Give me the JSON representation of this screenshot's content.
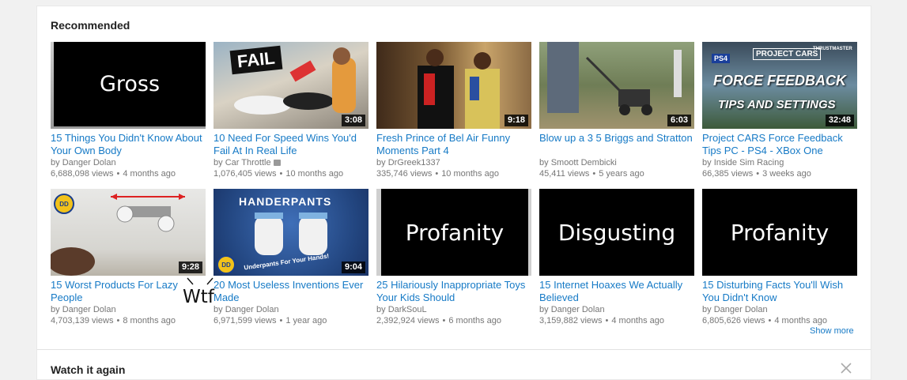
{
  "recommended": {
    "title": "Recommended",
    "show_more": "Show more"
  },
  "watch_again": {
    "title": "Watch it again"
  },
  "annotation": "Wtf",
  "videos": [
    {
      "title": "15 Things You Didn't Know About Your Own Body",
      "channel": "Danger Dolan",
      "views": "6,688,098 views",
      "age": "4 months ago",
      "duration": "",
      "cover": "Gross"
    },
    {
      "title": "10 Need For Speed Wins You'd Fail At In Real Life",
      "channel": "Car Throttle",
      "views": "1,076,405 views",
      "age": "10 months ago",
      "duration": "3:08",
      "thumb_text": "FAIL"
    },
    {
      "title": "Fresh Prince of Bel Air Funny Moments Part 4",
      "channel": "DrGreek1337",
      "views": "335,746 views",
      "age": "10 months ago",
      "duration": "9:18"
    },
    {
      "title": "Blow up a 3 5 Briggs and Stratton",
      "channel": "Smoott Dembicki",
      "views": "45,411 views",
      "age": "5 years ago",
      "duration": "6:03"
    },
    {
      "title": "Project CARS Force Feedback Tips PC - PS4 - XBox One",
      "channel": "Inside Sim Racing",
      "views": "66,385 views",
      "age": "3 weeks ago",
      "duration": "32:48",
      "thumb_lines": [
        "PS4",
        "PROJECT CARS",
        "THRUSTMASTER",
        "FORCE FEEDBACK",
        "TIPS AND SETTINGS"
      ]
    },
    {
      "title": "15 Worst Products For Lazy People",
      "channel": "Danger Dolan",
      "views": "4,703,139 views",
      "age": "8 months ago",
      "duration": "9:28",
      "badge": "DD"
    },
    {
      "title": "20 Most Useless Inventions Ever Made",
      "channel": "Danger Dolan",
      "views": "6,971,599 views",
      "age": "1 year ago",
      "duration": "9:04",
      "badge": "DD",
      "thumb_lines": [
        "HANDERPANTS",
        "Underpants For Your Hands!"
      ]
    },
    {
      "title": "25 Hilariously Inappropriate Toys Your Kids Should",
      "channel": "DarkSouL",
      "views": "2,392,924 views",
      "age": "6 months ago",
      "duration": "",
      "cover": "Profanity"
    },
    {
      "title": "15 Internet Hoaxes We Actually Believed",
      "channel": "Danger Dolan",
      "views": "3,159,882 views",
      "age": "4 months ago",
      "duration": "",
      "cover": "Disgusting"
    },
    {
      "title": "15 Disturbing Facts You'll Wish You Didn't Know",
      "channel": "Danger Dolan",
      "views": "6,805,626 views",
      "age": "4 months ago",
      "duration": "",
      "cover": "Profanity"
    }
  ],
  "colors": {
    "link": "#167ac6",
    "meta": "#767676",
    "background": "#f1f1f1"
  }
}
